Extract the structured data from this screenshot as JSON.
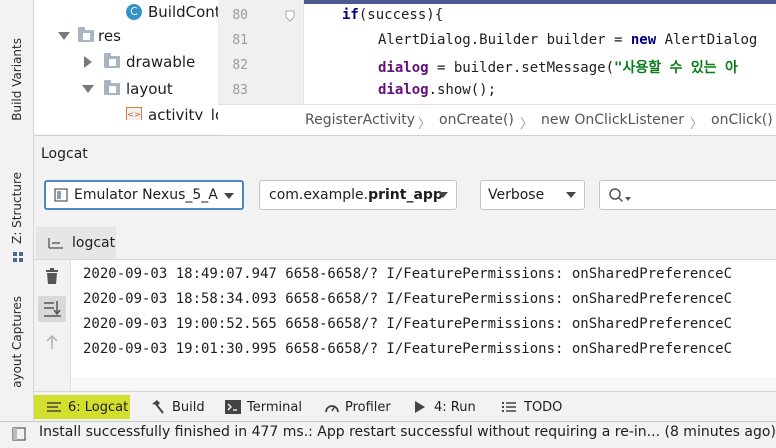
{
  "left_strip": {
    "tabs": [
      {
        "label": "Build Variants",
        "mnemonic_index": 0
      },
      {
        "label": "Z: Structure"
      },
      {
        "label": "Layout Captures"
      }
    ],
    "layout_captures_visible": "ayout Captures"
  },
  "project_tree": {
    "items": [
      {
        "label": "BuildCont",
        "icon": "c-class-icon"
      },
      {
        "label": "res",
        "icon": "folder-icon"
      },
      {
        "label": "drawable",
        "icon": "folder-icon"
      },
      {
        "label": "layout",
        "icon": "folder-icon"
      },
      {
        "label": "activity_lo",
        "icon": "xml-layout-icon"
      }
    ]
  },
  "editor": {
    "line_numbers": [
      "80",
      "81",
      "82",
      "83"
    ],
    "lines": [
      {
        "kw": "if",
        "rest": "(success){"
      },
      {
        "pre": "AlertDialog.Builder builder = ",
        "kw": "new",
        "rest": " AlertDialog"
      },
      {
        "fld": "dialog",
        "mid": " = builder.setMessage(",
        "str": "\"사용할 수 있는 아"
      },
      {
        "fld": "dialog",
        "mid": ".show();"
      }
    ],
    "breadcrumb": [
      "RegisterActivity",
      "onCreate()",
      "new OnClickListener",
      "onClick()"
    ]
  },
  "logcat": {
    "title": "Logcat",
    "device": "Emulator Nexus_5_A",
    "package_prefix": "com.example.",
    "package_name": "print_app",
    "level": "Verbose",
    "search_placeholder": "",
    "tab_label": "logcat",
    "lines": [
      "2020-09-03 18:49:07.947 6658-6658/? I/FeaturePermissions: onSharedPreferenceC",
      "2020-09-03 18:58:34.093 6658-6658/? I/FeaturePermissions: onSharedPreferenceC",
      "2020-09-03 19:00:52.565 6658-6658/? I/FeaturePermissions: onSharedPreferenceC",
      "2020-09-03 19:01:30.995 6658-6658/? I/FeaturePermissions: onSharedPreferenceC"
    ]
  },
  "bottom_tabs": [
    {
      "label": "6: Logcat",
      "icon": "list-icon",
      "active": true
    },
    {
      "label": "Build",
      "icon": "hammer-icon"
    },
    {
      "label": "Terminal",
      "icon": "terminal-icon"
    },
    {
      "label": "Profiler",
      "icon": "gauge-icon"
    },
    {
      "label": "4: Run",
      "icon": "run-icon"
    },
    {
      "label": "TODO",
      "icon": "todo-icon"
    }
  ],
  "status": {
    "message": "Install successfully finished in 477 ms.: App restart successful without requiring a re-in... (8 minutes ago)"
  },
  "colors": {
    "active_tab": "#d3df2d",
    "keyword": "#000080",
    "field": "#660e7a",
    "string": "#067d17",
    "device_combo_border": "#4a88c7"
  }
}
